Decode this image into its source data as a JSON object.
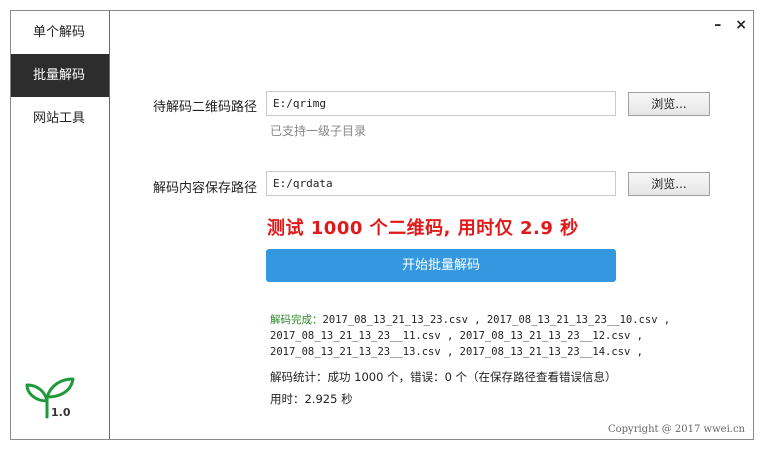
{
  "window": {
    "minimize_glyph": "–",
    "close_glyph": "×"
  },
  "sidebar": {
    "items": [
      {
        "label": "单个解码",
        "active": false
      },
      {
        "label": "批量解码",
        "active": true
      },
      {
        "label": "网站工具",
        "active": false
      }
    ],
    "logo_icon": "sprout-icon",
    "version": "1.0"
  },
  "form": {
    "source_label": "待解码二维码路径",
    "source_value": "E:/qrimg",
    "source_hint": "已支持一级子目录",
    "dest_label": "解码内容保存路径",
    "dest_value": "E:/qrdata",
    "browse_label": "浏览..."
  },
  "headline": "测试 1000 个二维码, 用时仅 2.9 秒",
  "start_button": "开始批量解码",
  "result": {
    "done_label": "解码完成：",
    "line1": "2017_08_13_21_13_23.csv , 2017_08_13_21_13_23__10.csv ,",
    "line2": "2017_08_13_21_13_23__11.csv , 2017_08_13_21_13_23__12.csv ,",
    "line3": "2017_08_13_21_13_23__13.csv , 2017_08_13_21_13_23__14.csv ,",
    "stats": "解码统计：成功 1000 个，错误：0 个（在保存路径查看错误信息）",
    "time": "用时：2.925 秒"
  },
  "footer": {
    "copyright": "Copyright @ 2017 wwei.cn"
  },
  "colors": {
    "accent": "#3597e0",
    "headline": "#e0191a",
    "done": "#2a8a2a",
    "nav_active": "#2d2d2d"
  }
}
